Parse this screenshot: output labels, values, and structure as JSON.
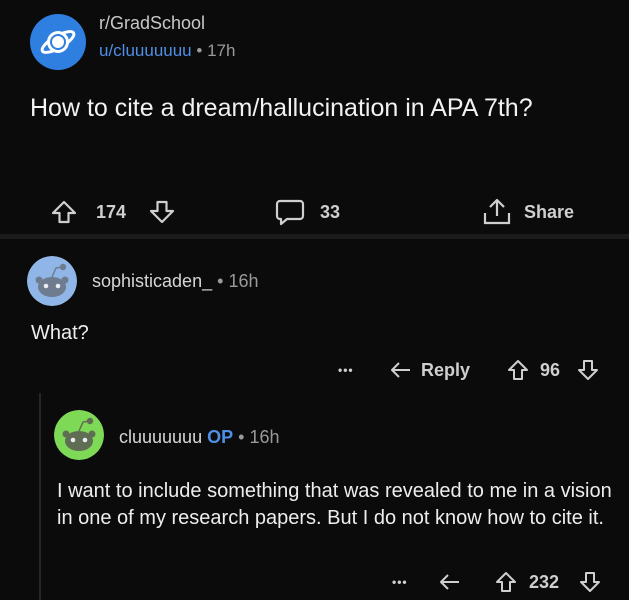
{
  "post": {
    "subreddit": "r/GradSchool",
    "author": "u/cluuuuuuu",
    "separator": "•",
    "age": "17h",
    "title": "How to cite a dream/hallucination in APA 7th?",
    "upvotes": "174",
    "comments_count": "33",
    "share_label": "Share"
  },
  "comments": [
    {
      "author": "sophisticaden_",
      "separator": "•",
      "age": "16h",
      "body": "What?",
      "more": "•••",
      "reply_label": "Reply",
      "score": "96",
      "avatar_color": "#8fb6e6"
    },
    {
      "author": "cluuuuuuu",
      "op_badge": "OP",
      "separator": "•",
      "age": "16h",
      "body": "I want to include something that was revealed to me in a vision in one of my research papers. But I do not know how to cite it.",
      "more": "•••",
      "score": "232",
      "avatar_color": "#7ed957"
    }
  ],
  "colors": {
    "background": "#0b0b0b",
    "accent_blue": "#4f8fe6",
    "subreddit_icon": "#2f7fe0"
  }
}
